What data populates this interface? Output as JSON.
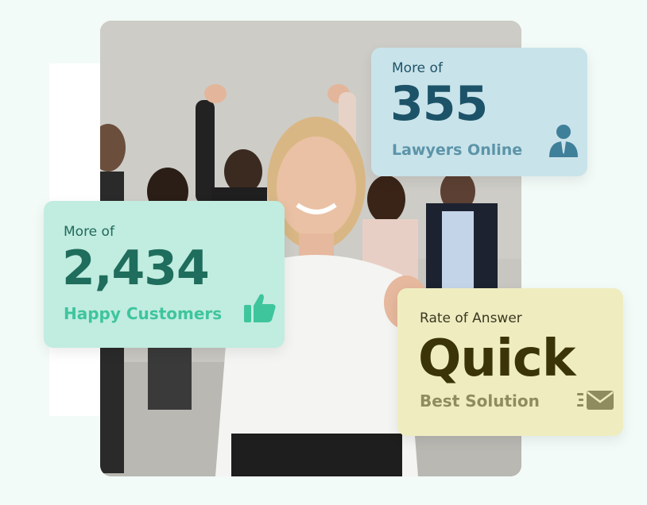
{
  "lawyers_card": {
    "pre_label": "More of",
    "value": "355",
    "caption": "Lawyers Online",
    "icon": "lawyer-icon",
    "color": "#1c5368"
  },
  "customers_card": {
    "pre_label": "More of",
    "value": "2,434",
    "caption": "Happy Customers",
    "icon": "thumbs-up-icon",
    "color": "#1f6d5c"
  },
  "answer_card": {
    "pre_label": "Rate of Answer",
    "value": "Quick",
    "caption": "Best Solution",
    "icon": "email-fast-icon",
    "color": "#3b3408"
  }
}
